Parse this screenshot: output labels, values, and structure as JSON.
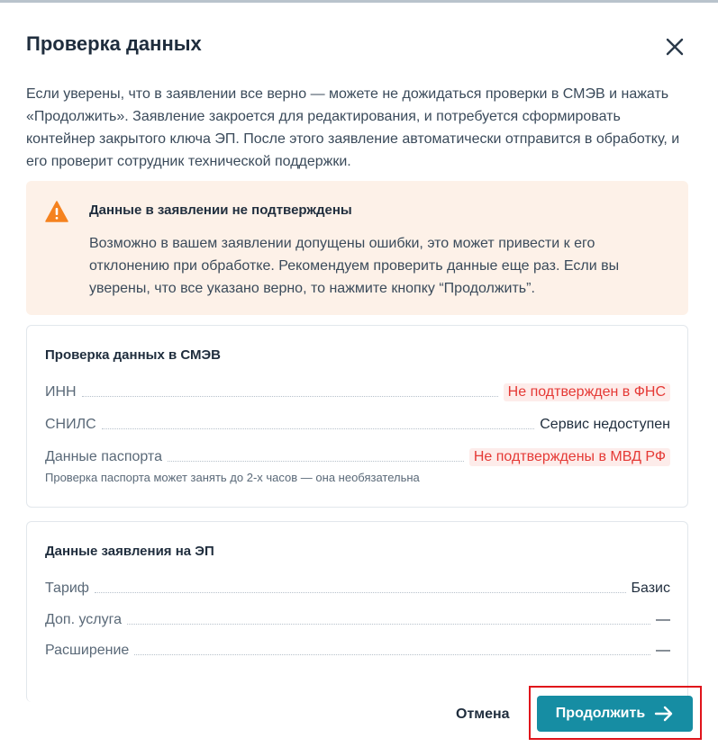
{
  "dialog": {
    "title": "Проверка данных",
    "intro": "Если уверены, что в заявлении все верно — можете не дожидаться проверки в СМЭВ и нажать «Продолжить». Заявление закроется для редактирования, и потребуется сформировать контейнер закрытого ключа ЭП. После этого заявление автоматически отправится в обработку, и его проверит сотрудник технической поддержки."
  },
  "warning": {
    "icon": "warning-triangle-icon",
    "title": "Данные в заявлении не подтверждены",
    "text": "Возможно в вашем заявлении допущены ошибки, это может привести к его отклонению при обработке. Рекомендуем проверить данные еще раз. Если вы уверены, что все указано верно, то нажмите кнопку “Продолжить”."
  },
  "smev": {
    "title": "Проверка данных в СМЭВ",
    "rows": [
      {
        "label": "ИНН",
        "value": "Не подтвержден в ФНС"
      },
      {
        "label": "СНИЛС",
        "value": "Сервис недоступен"
      },
      {
        "label": "Данные паспорта",
        "value": "Не подтверждены в МВД РФ"
      }
    ],
    "note": "Проверка паспорта может занять до 2-х часов — она необязательна"
  },
  "application": {
    "title": "Данные заявления на ЭП",
    "rows": [
      {
        "label": "Тариф",
        "value": "Базис"
      },
      {
        "label": "Доп. услуга",
        "value": "—"
      },
      {
        "label": "Расширение",
        "value": "—"
      }
    ]
  },
  "footer": {
    "cancel_label": "Отмена",
    "continue_label": "Продолжить"
  },
  "colors": {
    "accent": "#168da3",
    "error": "#e53935",
    "warning_bg": "#fdf1e8",
    "warning_icon": "#f5821f"
  }
}
